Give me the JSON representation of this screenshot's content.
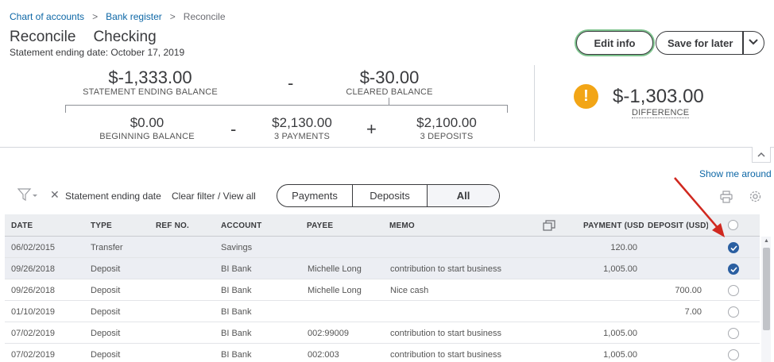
{
  "breadcrumb": {
    "items": [
      "Chart of accounts",
      "Bank register",
      "Reconcile"
    ],
    "separator": ">"
  },
  "header": {
    "title": "Reconcile",
    "account": "Checking",
    "subtitle": "Statement ending date: October 17, 2019",
    "edit_label": "Edit info",
    "save_label": "Save for later"
  },
  "summary": {
    "statement_ending_balance": "$-1,333.00",
    "statement_ending_balance_label": "STATEMENT ENDING BALANCE",
    "minus_op": "-",
    "cleared_balance": "$-30.00",
    "cleared_balance_label": "CLEARED BALANCE",
    "beginning_balance": "$0.00",
    "beginning_balance_label": "BEGINNING BALANCE",
    "payments_total": "$2,130.00",
    "payments_label": "3 PAYMENTS",
    "plus_op": "+",
    "deposits_total": "$2,100.00",
    "deposits_label": "3 DEPOSITS",
    "difference": "$-1,303.00",
    "difference_label": "DIFFERENCE",
    "warning_symbol": "!"
  },
  "toolbar": {
    "show_me_around": "Show me around",
    "filter_x": "✕",
    "filter_label": "Statement ending date",
    "clear_filter": "Clear filter / View all",
    "tabs": [
      "Payments",
      "Deposits",
      "All"
    ],
    "active_tab": "All"
  },
  "table": {
    "columns": [
      "DATE",
      "TYPE",
      "REF NO.",
      "ACCOUNT",
      "PAYEE",
      "MEMO",
      "PAYMENT (USD)",
      "DEPOSIT (USD)"
    ],
    "rows": [
      {
        "date": "06/02/2015",
        "type": "Transfer",
        "ref": "",
        "account": "Savings",
        "payee": "",
        "memo": "",
        "payment": "120.00",
        "deposit": "",
        "checked": true
      },
      {
        "date": "09/26/2018",
        "type": "Deposit",
        "ref": "",
        "account": "BI Bank",
        "payee": "Michelle Long",
        "memo": "contribution to start business",
        "payment": "1,005.00",
        "deposit": "",
        "checked": true
      },
      {
        "date": "09/26/2018",
        "type": "Deposit",
        "ref": "",
        "account": "BI Bank",
        "payee": "Michelle Long",
        "memo": "Nice cash",
        "payment": "",
        "deposit": "700.00",
        "checked": false
      },
      {
        "date": "01/10/2019",
        "type": "Deposit",
        "ref": "",
        "account": "BI Bank",
        "payee": "",
        "memo": "",
        "payment": "",
        "deposit": "7.00",
        "checked": false
      },
      {
        "date": "07/02/2019",
        "type": "Deposit",
        "ref": "",
        "account": "BI Bank",
        "payee": "002:99009",
        "memo": "contribution to start business",
        "payment": "1,005.00",
        "deposit": "",
        "checked": false
      },
      {
        "date": "07/02/2019",
        "type": "Deposit",
        "ref": "",
        "account": "BI Bank",
        "payee": "002:003",
        "memo": "contribution to start business",
        "payment": "1,005.00",
        "deposit": "",
        "checked": false
      }
    ]
  },
  "colors": {
    "link": "#0d67a6",
    "warning": "#f2a516",
    "check": "#2b5fa1",
    "annotation_arrow": "#d0281f"
  }
}
